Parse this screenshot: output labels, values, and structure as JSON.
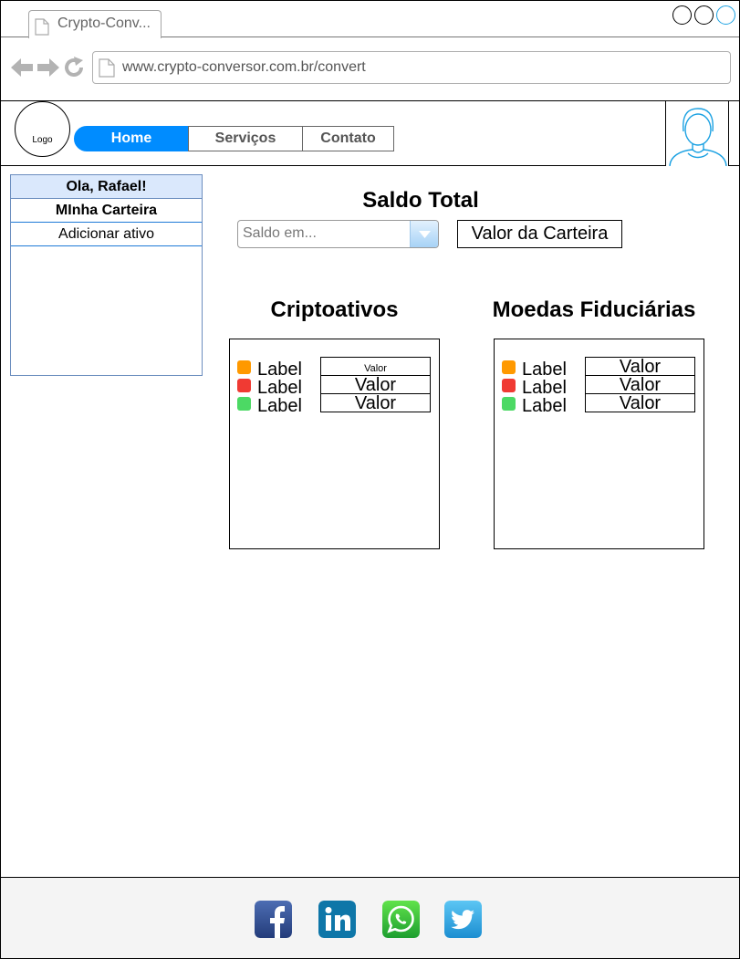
{
  "browser": {
    "tab_title": "Crypto-Conv...",
    "url": "www.crypto-conversor.com.br/convert"
  },
  "header": {
    "logo_text": "Logo",
    "nav": [
      "Home",
      "Serviços",
      "Contato"
    ]
  },
  "sidebar": {
    "greeting": "Ola, Rafael!",
    "items": [
      "MInha Carteira",
      "Adicionar ativo"
    ]
  },
  "balance": {
    "title": "Saldo Total",
    "select_placeholder": "Saldo em...",
    "wallet_value": "Valor da Carteira"
  },
  "crypto": {
    "title": "Criptoativos",
    "rows": [
      {
        "label": "Label",
        "value": "Valor",
        "color": "#ff9900"
      },
      {
        "label": "Label",
        "value": "Valor",
        "color": "#f03a33"
      },
      {
        "label": "Label",
        "value": "Valor",
        "color": "#4cd964"
      }
    ]
  },
  "fiat": {
    "title": "Moedas Fiduciárias",
    "rows": [
      {
        "label": "Label",
        "value": "Valor",
        "color": "#ff9900"
      },
      {
        "label": "Label",
        "value": "Valor",
        "color": "#f03a33"
      },
      {
        "label": "Label",
        "value": "Valor",
        "color": "#4cd964"
      }
    ]
  },
  "footer": {
    "social": [
      "facebook-icon",
      "linkedin-icon",
      "whatsapp-icon",
      "twitter-icon"
    ]
  }
}
